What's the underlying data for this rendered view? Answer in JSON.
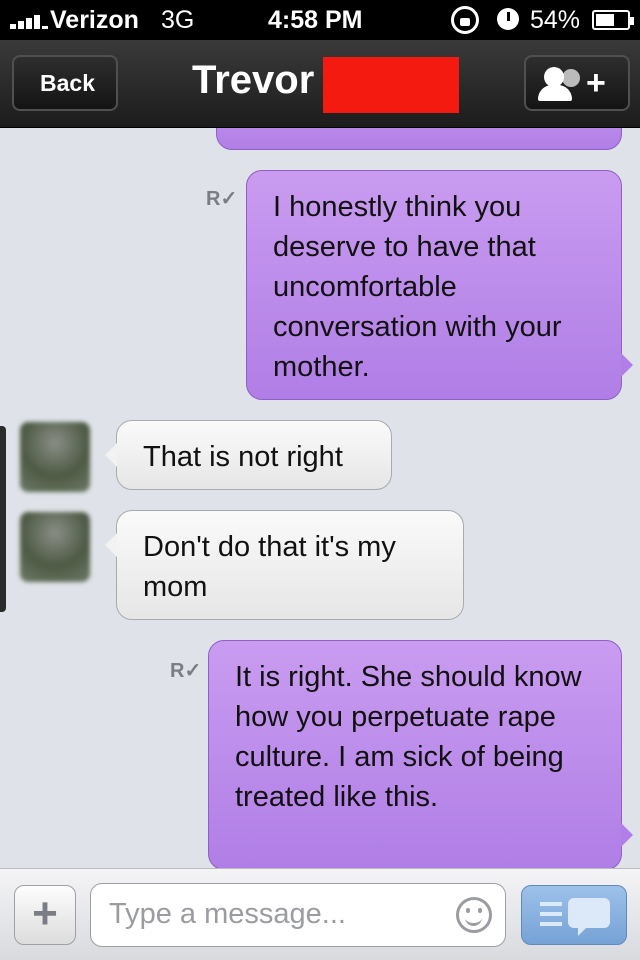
{
  "status_bar": {
    "carrier": "Verizon",
    "network": "3G",
    "time": "4:58 PM",
    "battery": "54%"
  },
  "nav": {
    "back_label": "Back",
    "title": "Trevor",
    "redaction_color": "#f51a10"
  },
  "messages": [
    {
      "direction": "sent",
      "text": "I honestly think you deserve to have that uncomfortable conversation with your mother.",
      "read_receipt": "R"
    },
    {
      "direction": "received",
      "text": "That is not right"
    },
    {
      "direction": "received",
      "text": "Don't do that it's my mom"
    },
    {
      "direction": "sent",
      "text": "It is right. She should know how you perpetuate rape culture. I am sick of being treated like this.",
      "read_receipt": "R"
    }
  ],
  "input": {
    "placeholder": "Type a message...",
    "attach_label": "+"
  },
  "colors": {
    "sent_bubble": "#b98bec",
    "received_bubble": "#f0f0f0",
    "background": "#dfe2e8",
    "send_button": "#86b0e0"
  },
  "icons": [
    "signal-icon",
    "rotation-lock-icon",
    "alarm-icon",
    "battery-icon",
    "add-contact-icon",
    "read-receipt-icon",
    "emoji-icon",
    "send-icon"
  ]
}
